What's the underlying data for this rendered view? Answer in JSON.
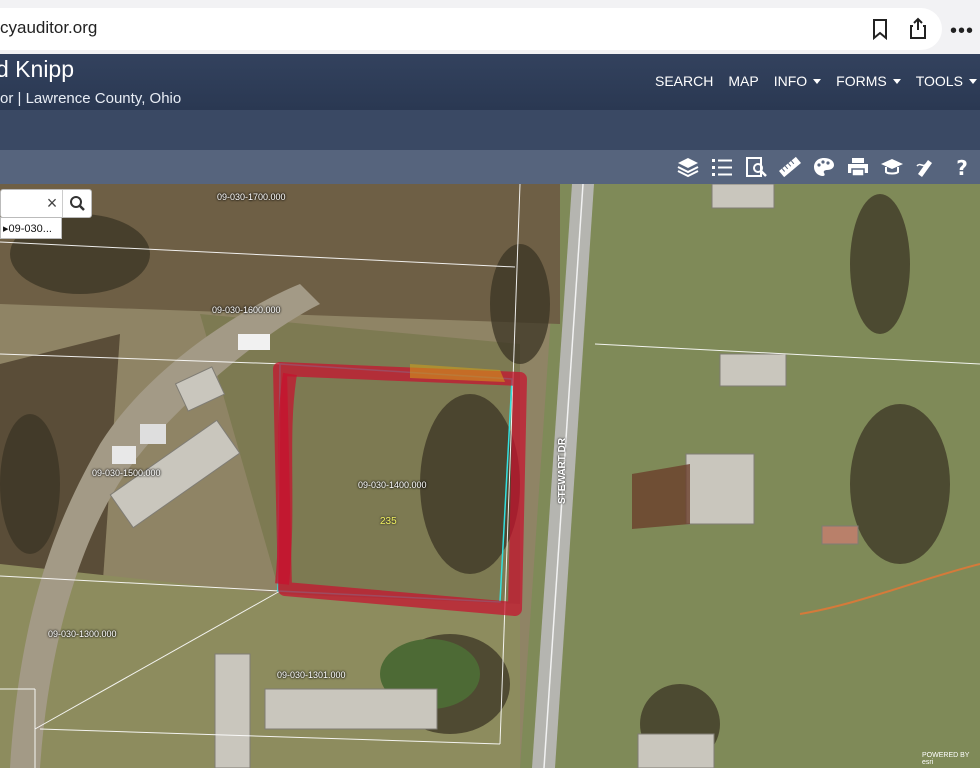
{
  "browser": {
    "url": "cyauditor.org"
  },
  "header": {
    "site_name": "d Knipp",
    "site_subtitle": "or | Lawrence County, Ohio",
    "nav": [
      {
        "label": "SEARCH",
        "dropdown": false
      },
      {
        "label": "MAP",
        "dropdown": false
      },
      {
        "label": "INFO",
        "dropdown": true
      },
      {
        "label": "FORMS",
        "dropdown": true
      },
      {
        "label": "TOOLS",
        "dropdown": true
      }
    ]
  },
  "toolbar": {
    "icons": [
      "layers-icon",
      "list-icon",
      "search-document-icon",
      "ruler-icon",
      "palette-icon",
      "print-icon",
      "graduation-cap-icon",
      "draw-icon",
      "help-icon"
    ]
  },
  "search": {
    "value": "",
    "suggestion": "09-030..."
  },
  "map": {
    "parcels": [
      "09-030-1700.000",
      "09-030-1600.000",
      "09-030-1500.000",
      "09-030-1400.000",
      "09-030-1300.000",
      "09-030-1301.000"
    ],
    "lot_number": "235",
    "road": "STEWART DR",
    "attribution": "POWERED BY esri"
  },
  "colors": {
    "header_bg": "#2e3c57",
    "toolbar_bg": "#56647d",
    "highlight": "#c8102e"
  }
}
